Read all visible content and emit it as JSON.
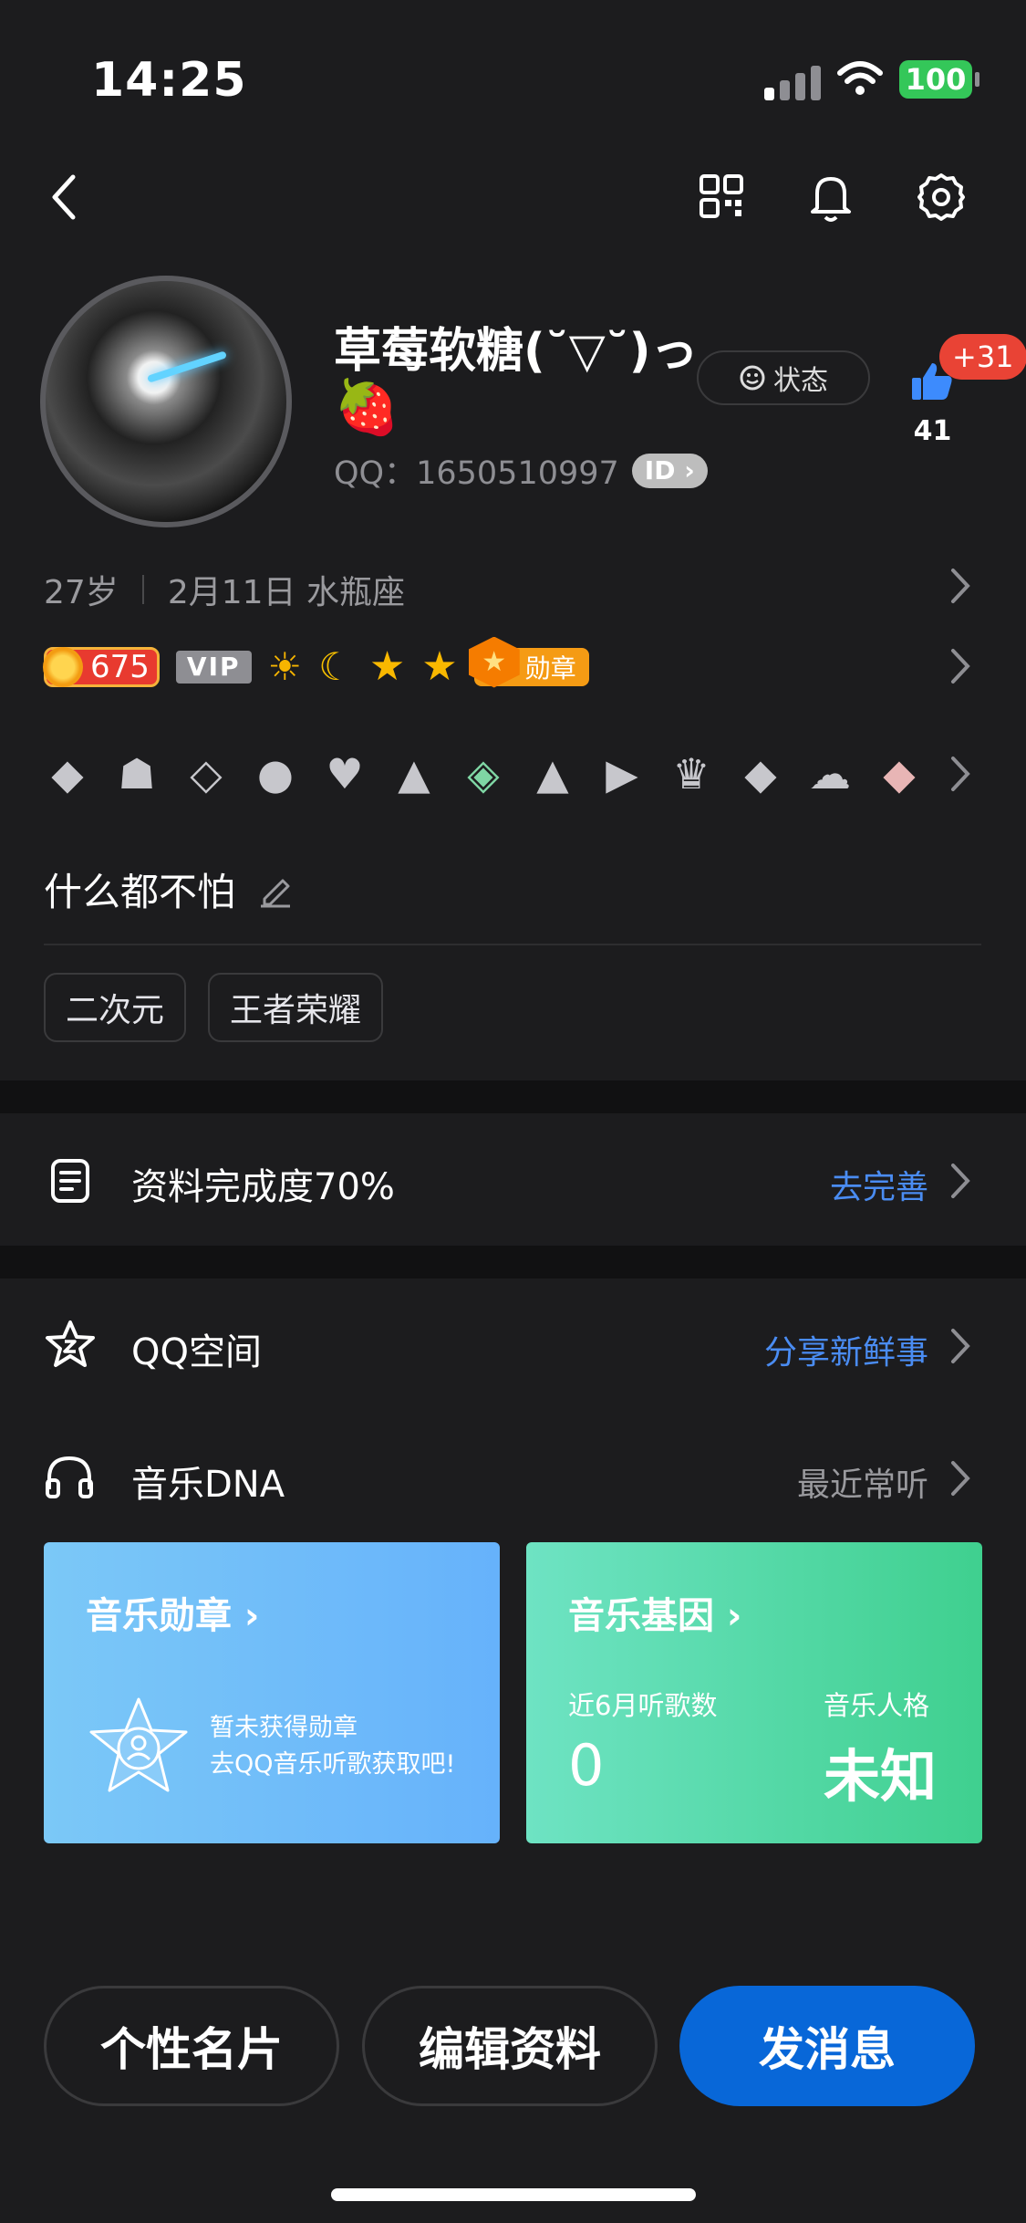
{
  "status_bar": {
    "time": "14:25",
    "battery": "100"
  },
  "profile": {
    "nickname": "草莓软糖(˘▽˘)っ",
    "emoji": "🍓",
    "qq_label": "QQ：",
    "qq_number": "1650510997",
    "id_badge": "ID",
    "status_label": "状态",
    "like_increase": "+31",
    "like_count": "41",
    "age": "27岁",
    "birthday": "2月11日 水瓶座",
    "level": "675",
    "vip_label": "VIP",
    "medal_label": "勋章",
    "signature": "什么都不怕",
    "tags": [
      "二次元",
      "王者荣耀"
    ]
  },
  "rows": {
    "completion": {
      "label": "资料完成度70%",
      "action": "去完善"
    },
    "qzone": {
      "label": "QQ空间",
      "action": "分享新鲜事"
    },
    "music": {
      "label": "音乐DNA",
      "action": "最近常听"
    }
  },
  "music_cards": {
    "badge": {
      "title": "音乐勋章",
      "line1": "暂未获得勋章",
      "line2": "去QQ音乐听歌获取吧!"
    },
    "gene": {
      "title": "音乐基因",
      "plays_label": "近6月听歌数",
      "plays_value": "0",
      "persona_label": "音乐人格",
      "persona_value": "未知"
    }
  },
  "buttons": {
    "card": "个性名片",
    "edit": "编辑资料",
    "message": "发消息"
  },
  "colors": {
    "background": "#1c1c1e",
    "accent": "#0867d8",
    "link": "#4a8cf2",
    "battery": "#34c759",
    "like_badge": "#e94335"
  }
}
